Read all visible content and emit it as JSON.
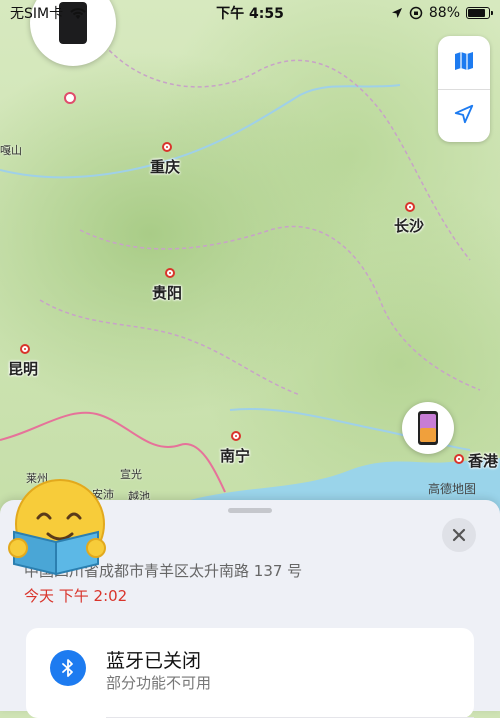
{
  "status_bar": {
    "carrier": "无SIM卡",
    "time": "下午 4:55",
    "battery_percent": "88%",
    "battery_level": 0.88
  },
  "map": {
    "cities": {
      "chongqing": "重庆",
      "guiyang": "贵阳",
      "kunming": "昆明",
      "nanning": "南宁",
      "changsha": "长沙",
      "hongkong": "香港",
      "ga_shan": "嘎山"
    },
    "small_labels": {
      "laizhou": "莱州",
      "xuanguang": "宣光",
      "anpei": "安沛",
      "yuechi": "越池"
    },
    "provider": "高德地图",
    "controls": {
      "map_icon": "map-icon",
      "location_icon": "location-arrow-icon"
    },
    "colors": {
      "pin_red": "#d9342b",
      "accent_blue": "#1d7bf0"
    }
  },
  "sheet": {
    "address": "中国四川省成都市青羊区太升南路 137 号",
    "time": "今天 下午 2:02",
    "bluetooth_title": "蓝牙已关闭",
    "bluetooth_subtitle": "部分功能不可用"
  }
}
